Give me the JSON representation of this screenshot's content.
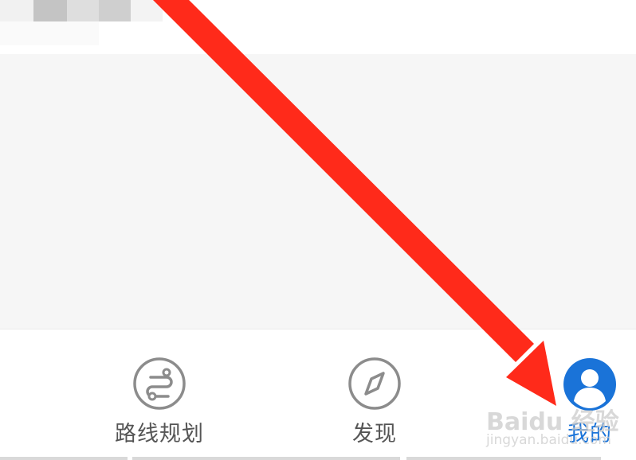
{
  "tab_bar": {
    "tabs": [
      {
        "label": "路线规划",
        "icon": "route-plan-icon",
        "active": false
      },
      {
        "label": "发现",
        "icon": "compass-icon",
        "active": false
      },
      {
        "label": "我的",
        "icon": "user-avatar-icon",
        "active": true
      }
    ]
  },
  "watermark": {
    "main": "Baidu 经验",
    "sub": "jingyan.baidu.com"
  },
  "colors": {
    "active_tab": "#1a73d8",
    "inactive_tab": "#555555",
    "content_background": "#f6f6f6",
    "annotation_arrow": "#ff2a1a"
  }
}
